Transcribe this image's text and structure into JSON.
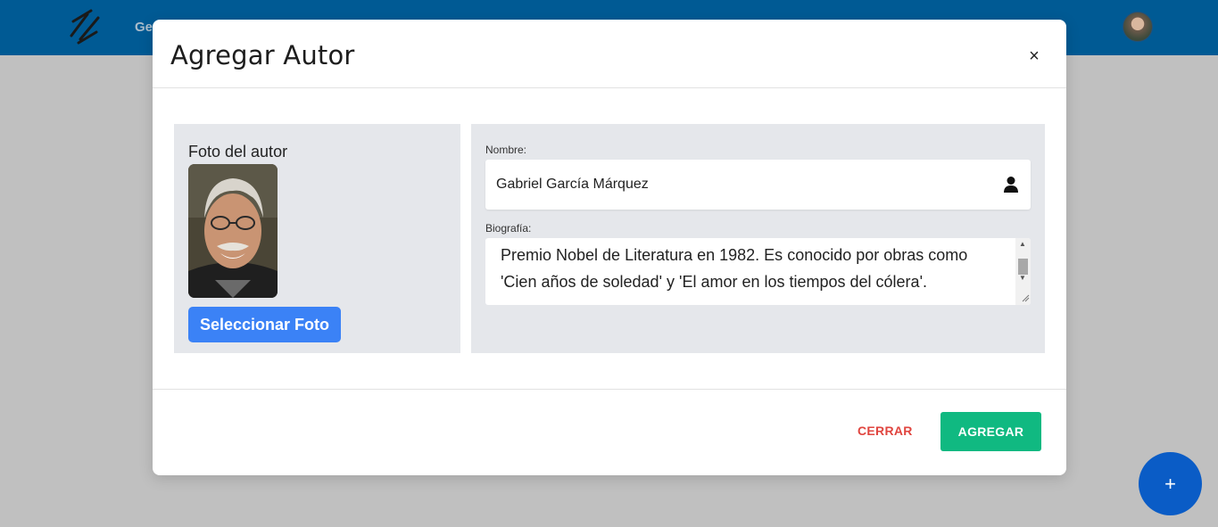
{
  "app": {
    "nav_text": "Ge"
  },
  "modal": {
    "title": "Agregar Autor",
    "close_label": "×",
    "photo_section": {
      "label": "Foto del autor",
      "select_button": "Seleccionar Foto"
    },
    "form": {
      "name_label": "Nombre:",
      "name_value": "Gabriel García Márquez",
      "bio_label": "Biografía:",
      "bio_visible_lines": [
        "Premio Nobel de Literatura en 1982. Es conocido por obras como",
        "'Cien años de soledad' y 'El amor en los tiempos del cólera'."
      ]
    },
    "footer": {
      "close_button": "CERRAR",
      "add_button": "AGREGAR"
    }
  },
  "fab": {
    "label": "+"
  },
  "colors": {
    "topbar": "#005a94",
    "primary_button": "#3b82f6",
    "add_button": "#10b981",
    "close_text": "#e0453f",
    "fab": "#0a5cc6"
  }
}
